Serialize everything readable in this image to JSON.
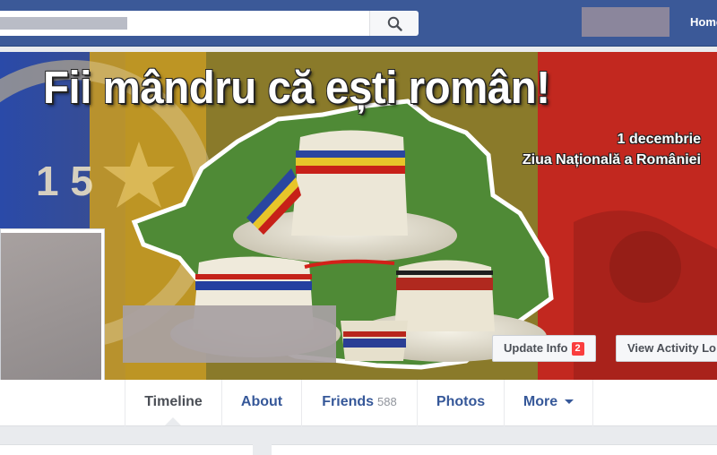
{
  "topbar": {
    "home_label": "Home",
    "search_icon": "search-icon"
  },
  "cover": {
    "title": "Fii mândru că ești român!",
    "date": "1 decembrie",
    "subtitle": "Ziua Națională a României",
    "colors": {
      "blue": "#1f3a8c",
      "yellow": "#e8b81e",
      "red": "#c8261e"
    }
  },
  "actions": {
    "update_info_label": "Update Info",
    "update_info_badge": "2",
    "view_activity_label": "View Activity Lo"
  },
  "nav": {
    "timeline": "Timeline",
    "about": "About",
    "friends": "Friends",
    "friends_count": "588",
    "photos": "Photos",
    "more": "More"
  }
}
